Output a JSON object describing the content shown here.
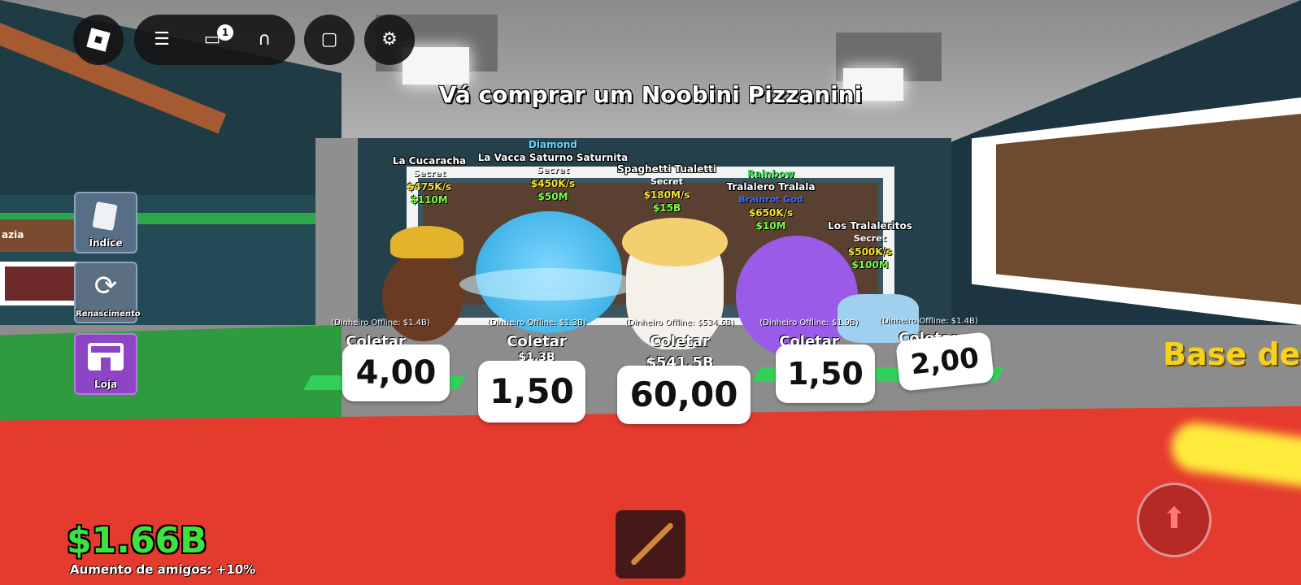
{
  "top_bar": {
    "chat_badge": "1"
  },
  "prompt": "Vá comprar um Noobini Pizzanini",
  "side_menu": [
    {
      "label": "Índice"
    },
    {
      "label": "Renascimento"
    },
    {
      "label": "Loja"
    }
  ],
  "wall_sign_left": "azia",
  "base_sign": "Base de I",
  "brainrots": [
    {
      "tier": "",
      "name": "La Cucaracha",
      "rarity": "Secret",
      "rate": "$475K/s",
      "price": "$110M",
      "offline": "(Dinheiro Offline: $1.4B)",
      "collect": "Coletar",
      "bubble": "4,00"
    },
    {
      "tier": "Diamond",
      "name": "La Vacca Saturno Saturnita",
      "rarity": "Secret",
      "rate": "$450K/s",
      "price": "$50M",
      "offline": "(Dinheiro Offline: $1.3B)",
      "collect": "Coletar",
      "stored": "$1.3B",
      "bubble": "1,50"
    },
    {
      "tier": "",
      "name": "Spaghetti Tualetti",
      "rarity": "Secret",
      "rate": "$180M/s",
      "price": "$15B",
      "offline": "(Dinheiro Offline: $534.6B)",
      "collect": "Coletar",
      "stored": "$541.5B",
      "bubble": "60,00"
    },
    {
      "tier": "Rainbow",
      "name": "Tralalero Tralala",
      "rarity": "Brainrot God",
      "rate": "$650K/s",
      "price": "$10M",
      "offline": "(Dinheiro Offline: $1.9B)",
      "collect": "Coletar",
      "bubble": "1,50"
    },
    {
      "tier": "",
      "name": "Los Tralaleritos",
      "rarity": "Secret",
      "rate": "$500K/s",
      "price": "$100M",
      "offline": "(Dinheiro Offline: $1.4B)",
      "collect": "Coletar",
      "bubble": "2,00"
    }
  ],
  "hud": {
    "money": "$1.66B",
    "friend_boost": "Aumento de amigos: +10%"
  },
  "colors": {
    "money_green": "#3ee23e",
    "floor_red": "#e53a2e",
    "diamond": "#5fd6ff",
    "rainbow": "#3fe35c"
  }
}
